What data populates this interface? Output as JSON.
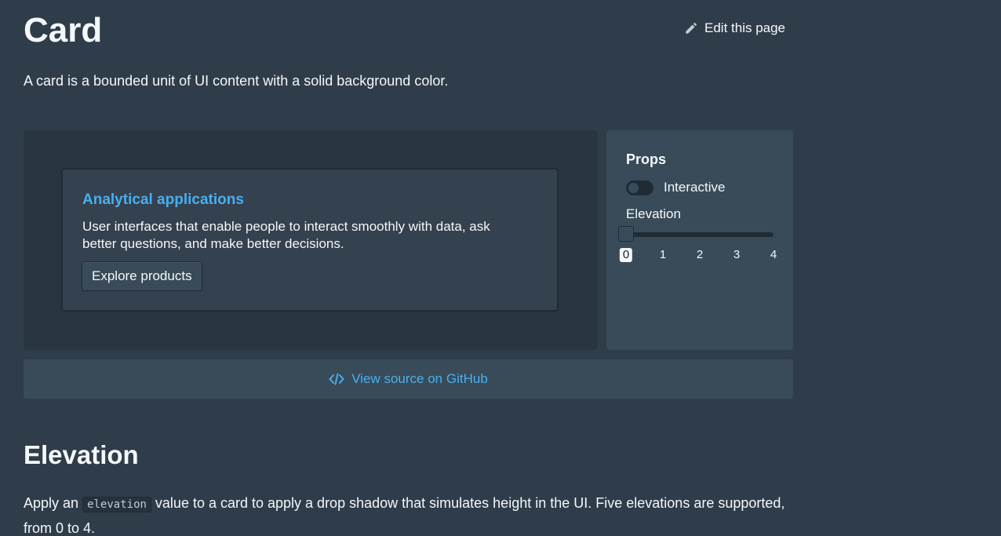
{
  "header": {
    "title": "Card",
    "edit_label": "Edit this page"
  },
  "intro": "A card is a bounded unit of UI content with a solid background color.",
  "example": {
    "card": {
      "title": "Analytical applications",
      "body": "User interfaces that enable people to interact smoothly with data, ask better questions, and make better decisions.",
      "button_label": "Explore products"
    }
  },
  "props": {
    "title": "Props",
    "interactive_label": "Interactive",
    "interactive_on": false,
    "elevation_label": "Elevation",
    "elevation_value": 0,
    "elevation_ticks": [
      "0",
      "1",
      "2",
      "3",
      "4"
    ]
  },
  "source": {
    "label": "View source on GitHub"
  },
  "elevation_section": {
    "title": "Elevation",
    "text_before": "Apply an ",
    "code": "elevation",
    "text_after": " value to a card to apply a drop shadow that simulates height in the UI. Five elevations are supported, from 0 to 4."
  },
  "colors": {
    "background": "#2f3d4b",
    "accent": "#48aff0",
    "panel": "#394b59",
    "example_bg": "#293541"
  },
  "icons": {
    "edit": "pencil-icon",
    "source": "code-icon"
  }
}
